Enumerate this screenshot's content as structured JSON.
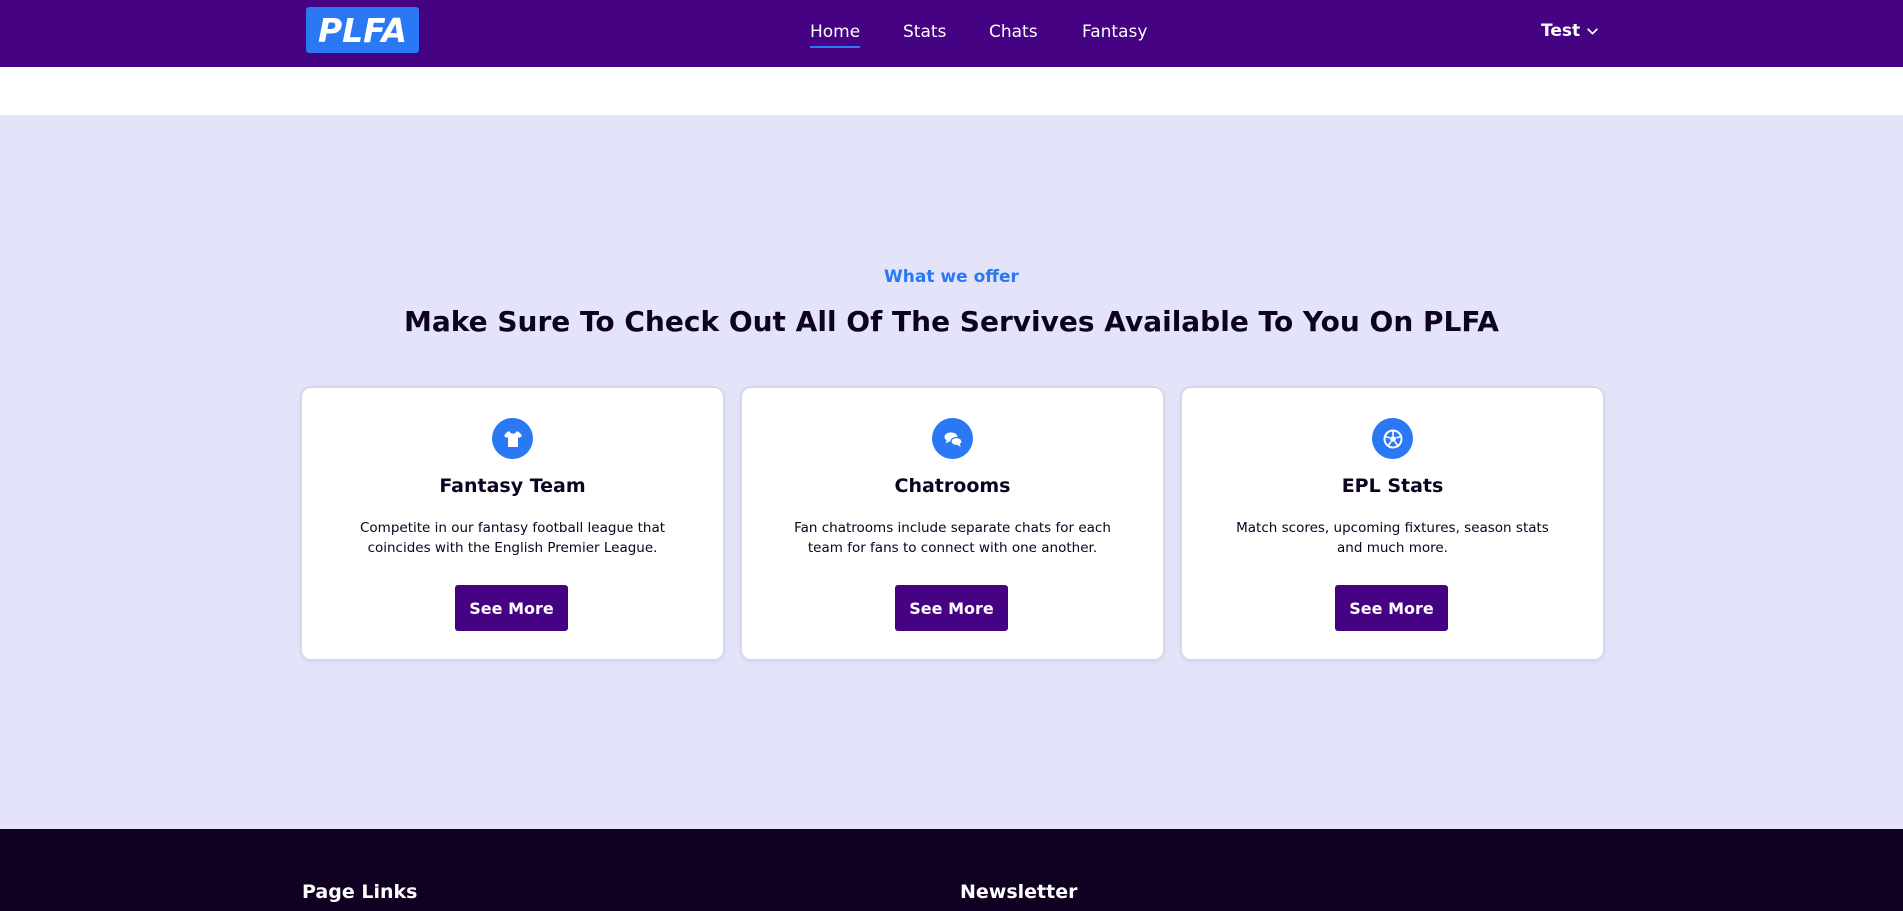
{
  "brand": {
    "logo_text": "PLFA",
    "logo_color": "#2a78f4"
  },
  "nav": {
    "links": [
      {
        "label": "Home",
        "active": true
      },
      {
        "label": "Stats",
        "active": false
      },
      {
        "label": "Chats",
        "active": false
      },
      {
        "label": "Fantasy",
        "active": false
      }
    ],
    "user_label": "Test",
    "user_icon": "chevron-down-icon"
  },
  "colors": {
    "navbar": "#450283",
    "accent": "#2a78f4",
    "section_bg": "#e3e4f9",
    "footer_bg": "#100122",
    "button_bg": "#450283"
  },
  "offer": {
    "eyebrow": "What we offer",
    "heading": "Make Sure To Check Out All Of The Servives Available To You On PLFA",
    "cards": [
      {
        "icon": "shirt-icon",
        "title": "Fantasy Team",
        "description": "Competite in our fantasy football league that coincides with the English Premier League.",
        "button": "See More"
      },
      {
        "icon": "chat-bubbles-icon",
        "title": "Chatrooms",
        "description": "Fan chatrooms include separate chats for each team for fans to connect with one another.",
        "button": "See More"
      },
      {
        "icon": "football-icon",
        "title": "EPL Stats",
        "description": "Match scores, upcoming fixtures, season stats and much more.",
        "button": "See More"
      }
    ]
  },
  "footer": {
    "page_links_heading": "Page Links",
    "newsletter_heading": "Newsletter"
  }
}
